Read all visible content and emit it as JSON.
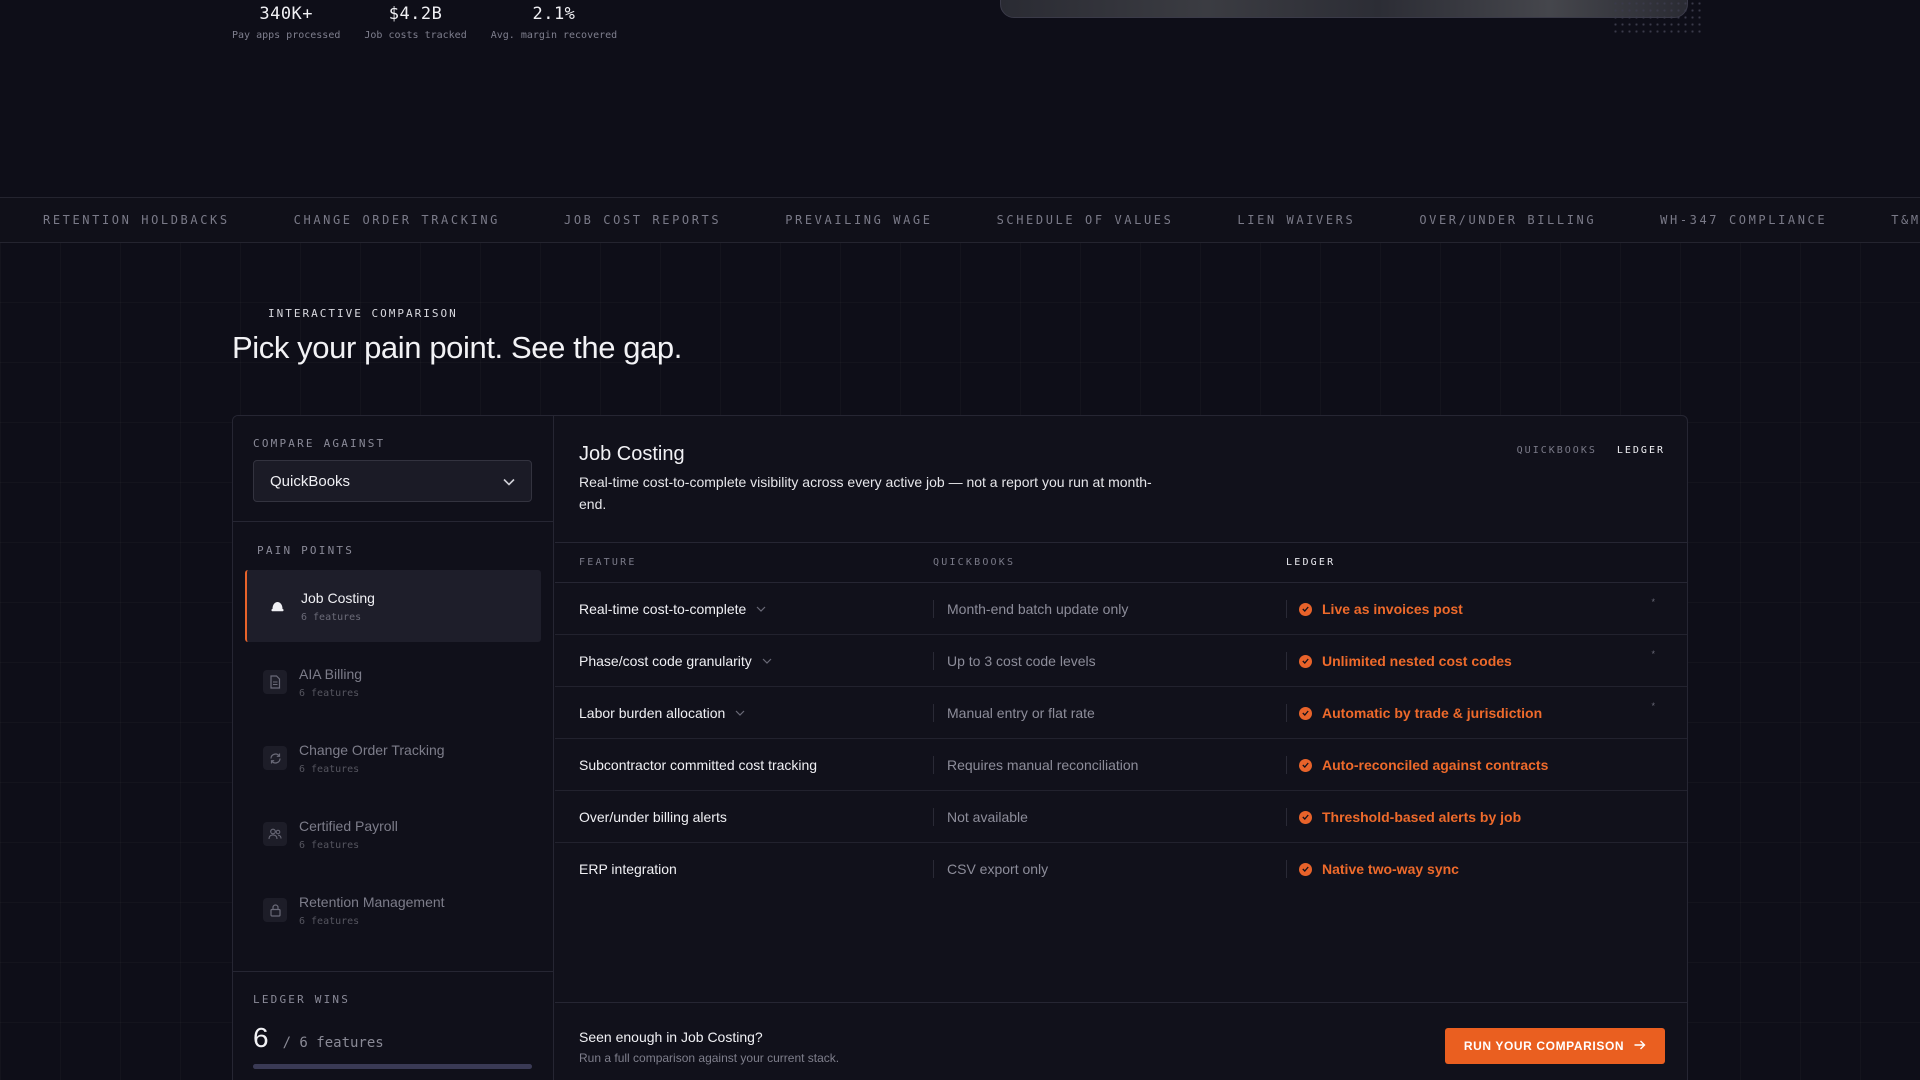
{
  "stats": [
    {
      "value": "340K+",
      "label": "Pay apps processed"
    },
    {
      "value": "$4.2B",
      "label": "Job costs tracked"
    },
    {
      "value": "2.1%",
      "label": "Avg. margin recovered"
    }
  ],
  "ticker": [
    "RETENTION HOLDBACKS",
    "CHANGE ORDER TRACKING",
    "JOB COST REPORTS",
    "PREVAILING WAGE",
    "SCHEDULE OF VALUES",
    "LIEN WAIVERS",
    "OVER/UNDER BILLING",
    "WH-347 COMPLIANCE",
    "T&M TI"
  ],
  "section": {
    "eyebrow": "INTERACTIVE COMPARISON",
    "headline": "Pick your pain point. See the gap."
  },
  "sidebar": {
    "compare_label": "COMPARE AGAINST",
    "compare_value": "QuickBooks",
    "pain_points_label": "PAIN POINTS",
    "items": [
      {
        "label": "Job Costing",
        "sub": "6 features",
        "icon": "hard-hat-icon",
        "active": true
      },
      {
        "label": "AIA Billing",
        "sub": "6 features",
        "icon": "document-icon",
        "active": false
      },
      {
        "label": "Change Order Tracking",
        "sub": "6 features",
        "icon": "refresh-icon",
        "active": false
      },
      {
        "label": "Certified Payroll",
        "sub": "6 features",
        "icon": "users-icon",
        "active": false
      },
      {
        "label": "Retention Management",
        "sub": "6 features",
        "icon": "lock-icon",
        "active": false
      }
    ],
    "wins_label": "LEDGER WINS",
    "wins_value": "6",
    "wins_of": "/ 6 features",
    "wins_fraction": 1.0
  },
  "main": {
    "title": "Job Costing",
    "description": "Real-time cost-to-complete visibility across every active job — not a report you run at month-end.",
    "toggle": [
      "QUICKBOOKS",
      "LEDGER"
    ],
    "columns": [
      "FEATURE",
      "QUICKBOOKS",
      "LEDGER"
    ],
    "rows": [
      {
        "feature": "Real-time cost-to-complete",
        "competitor": "Month-end batch update only",
        "ledger": "Live as invoices post",
        "expandable": true
      },
      {
        "feature": "Phase/cost code granularity",
        "competitor": "Up to 3 cost code levels",
        "ledger": "Unlimited nested cost codes",
        "expandable": true
      },
      {
        "feature": "Labor burden allocation",
        "competitor": "Manual entry or flat rate",
        "ledger": "Automatic by trade & jurisdiction",
        "expandable": true
      },
      {
        "feature": "Subcontractor committed cost tracking",
        "competitor": "Requires manual reconciliation",
        "ledger": "Auto-reconciled against contracts",
        "expandable": false
      },
      {
        "feature": "Over/under billing alerts",
        "competitor": "Not available",
        "ledger": "Threshold-based alerts by job",
        "expandable": false
      },
      {
        "feature": "ERP integration",
        "competitor": "CSV export only",
        "ledger": "Native two-way sync",
        "expandable": false
      }
    ],
    "footer_title": "Seen enough in Job Costing?",
    "footer_sub": "Run a full comparison against your current stack.",
    "cta_label": "RUN YOUR COMPARISON"
  },
  "colors": {
    "accent": "#ea5f20",
    "background": "#0e0e18"
  }
}
